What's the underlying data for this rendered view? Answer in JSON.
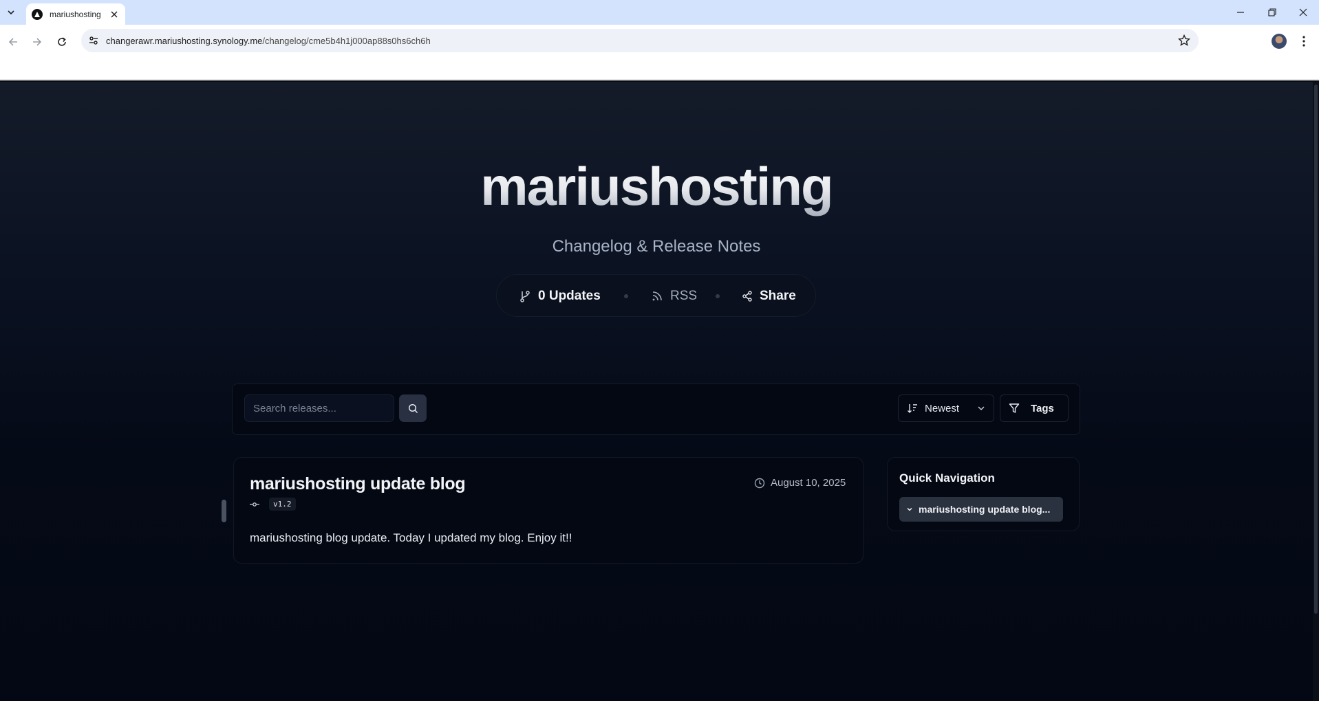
{
  "browser": {
    "tab_title": "mariushosting",
    "url_host": "changerawr.mariushosting.synology.me",
    "url_path": "/changelog/cme5b4h1j000ap88s0hs6ch6h"
  },
  "hero": {
    "title": "mariushosting",
    "subtitle": "Changelog & Release Notes"
  },
  "stats": {
    "updates_label": "0 Updates",
    "rss_label": "RSS",
    "share_label": "Share"
  },
  "filters": {
    "search_placeholder": "Search releases...",
    "sort_value": "Newest",
    "tags_label": "Tags"
  },
  "entries": [
    {
      "title": "mariushosting update blog",
      "date": "August 10, 2025",
      "version": "v1.2",
      "body": "mariushosting blog update. Today I updated my blog. Enjoy it!!"
    }
  ],
  "quick_nav": {
    "title": "Quick Navigation",
    "items": [
      {
        "label": "mariushosting update blog..."
      }
    ]
  },
  "icons": {
    "updates": "git-branch-icon",
    "rss": "rss-icon",
    "share": "share-icon",
    "search": "search-icon",
    "sort": "sort-icon",
    "tags": "filter-icon",
    "date": "clock-icon",
    "version": "git-commit-icon"
  },
  "colors": {
    "page_background": "#050a17",
    "accent_button": "#283042",
    "quick_nav_item": "#2a313f"
  }
}
